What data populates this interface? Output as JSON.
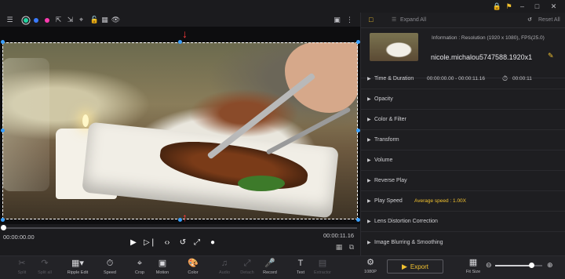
{
  "preview_toolbar": {
    "icons": [
      "fit-icon",
      "color-dot-green",
      "color-dot-blue",
      "color-dot-pink",
      "transform-icon",
      "transform-icon-2",
      "crop-icon",
      "lock-icon",
      "eye-icon"
    ],
    "dot_colors": [
      "#22d3a0",
      "#3a7bff",
      "#ff3bb0"
    ],
    "snapshot_icon": "camera-icon",
    "more_icon": "ellipsis-icon"
  },
  "topbar": {
    "icons": [
      "lock-icon",
      "bell-icon",
      "minimize-icon",
      "maximize-icon",
      "close-icon"
    ]
  },
  "timeline": {
    "current_time": "00:00:00.00",
    "total_time": "00:00:11.16"
  },
  "bottom_toolbar": {
    "tools": [
      {
        "label": "Split",
        "icon": "scissors-icon",
        "enabled": false
      },
      {
        "label": "Split all",
        "icon": "split-all-icon",
        "enabled": false
      },
      {
        "label": "Ripple Edit",
        "icon": "ripple-edit-icon",
        "enabled": true
      },
      {
        "label": "Speed",
        "icon": "speed-icon",
        "enabled": true
      },
      {
        "label": "Crop",
        "icon": "crop-icon",
        "enabled": true
      },
      {
        "label": "Motion",
        "icon": "motion-icon",
        "enabled": true
      },
      {
        "label": "Color",
        "icon": "palette-icon",
        "enabled": true
      },
      {
        "label": "Audio",
        "icon": "audio-icon",
        "enabled": false
      },
      {
        "label": "Detach",
        "icon": "detach-icon",
        "enabled": false
      },
      {
        "label": "Record",
        "icon": "mic-icon",
        "enabled": true
      },
      {
        "label": "Text",
        "icon": "text-icon",
        "enabled": true
      },
      {
        "label": "Extractor",
        "icon": "extractor-icon",
        "enabled": false
      }
    ],
    "quality_label": "1080P",
    "export_label": "Export",
    "fit_size_label": "Fit Size",
    "zoom_level": 0.78
  },
  "properties": {
    "expand_all": "Expand All",
    "reset_all": "Reset All",
    "info_text": "Information : Resolution (1920 x 1080), FPS(25.0)",
    "filename": "nicole.michalou5747588.1920x1",
    "rows": [
      {
        "title": "Time & Duration",
        "range": "00:00:00.00 - 00:00:11.16",
        "duration": "00:00:11"
      },
      {
        "title": "Opacity"
      },
      {
        "title": "Color & Filter"
      },
      {
        "title": "Transform"
      },
      {
        "title": "Volume"
      },
      {
        "title": "Reverse Play"
      },
      {
        "title": "Play Speed",
        "value": "Average speed : 1.00X",
        "value_color": "#f2c230"
      },
      {
        "title": "Lens Distortion Correction"
      },
      {
        "title": "Image Blurring & Smoothing"
      }
    ]
  },
  "colors": {
    "accent": "#f2c230",
    "crop_handle": "#3aa0ff",
    "arrow": "#ff3b3b"
  }
}
